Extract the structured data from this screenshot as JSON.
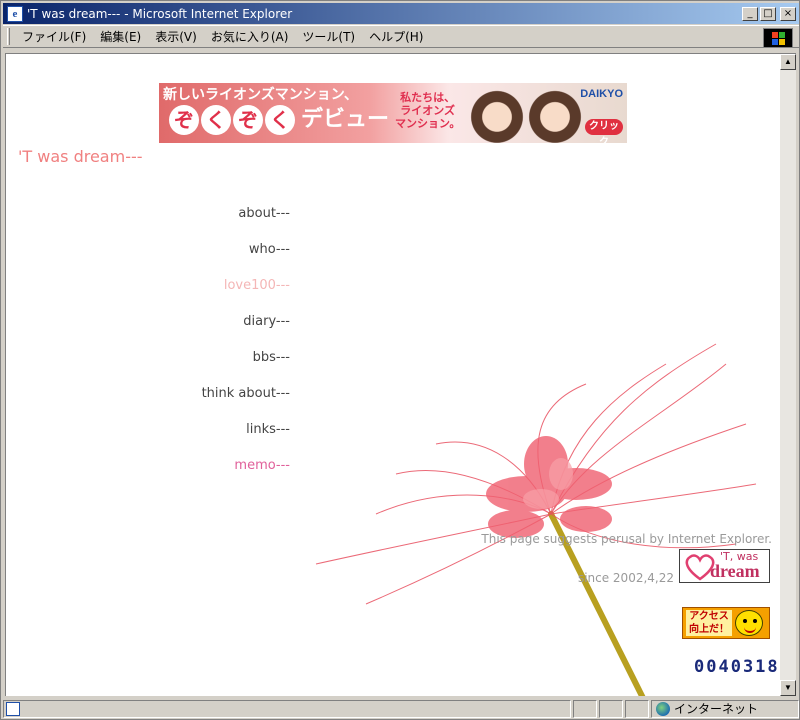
{
  "window": {
    "title": "'T was dream--- - Microsoft Internet Explorer",
    "controls": [
      "_",
      "□",
      "×"
    ]
  },
  "menubar": {
    "items": [
      "ファイル(F)",
      "編集(E)",
      "表示(V)",
      "お気に入り(A)",
      "ツール(T)",
      "ヘルプ(H)"
    ]
  },
  "banner": {
    "line1": "新しいライオンズマンション、",
    "big_chars": [
      "ぞ",
      "く",
      "ぞ",
      "く"
    ],
    "debut": "デビュー",
    "tag_line1": "私たちは、",
    "tag_line2": "ライオンズ",
    "tag_line3": "マンション。",
    "brand": "DAIKYO",
    "click": "クリック"
  },
  "page": {
    "site_title": "'T was dream---",
    "nav": [
      {
        "label": "about---",
        "style": "normal"
      },
      {
        "label": "who---",
        "style": "normal"
      },
      {
        "label": "love100---",
        "style": "faded"
      },
      {
        "label": "diary---",
        "style": "normal"
      },
      {
        "label": "bbs---",
        "style": "normal"
      },
      {
        "label": "think about---",
        "style": "normal"
      },
      {
        "label": "links---",
        "style": "normal"
      },
      {
        "label": "memo---",
        "style": "accent"
      }
    ],
    "browser_note": "This page suggests perusal by Internet Explorer.",
    "since": "since 2002,4,22",
    "logo_small": "'T, was",
    "logo_big": "dream",
    "access_badge": "アクセス 向上だ！",
    "counter": "0040318"
  },
  "statusbar": {
    "zone": "インターネット"
  },
  "colors": {
    "title_pink": "#f08080",
    "nav_text": "#444444",
    "nav_faded": "#f4b6b6",
    "nav_accent": "#e0609a",
    "counter": "#1a2a7a"
  }
}
